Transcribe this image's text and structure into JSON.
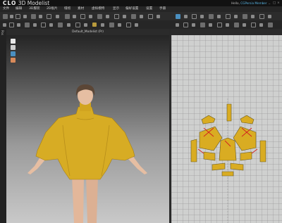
{
  "app": {
    "brand": "CLO",
    "product": "3D Modelist",
    "greeting_prefix": "Hello,",
    "user_name": "CGPersia Member",
    "window_controls": [
      "_",
      "□",
      "×"
    ]
  },
  "menu": {
    "items": [
      "文件",
      "编辑",
      "3D服装",
      "2D板片",
      "缝纫",
      "素材",
      "虚拟模特",
      "显示",
      "偏好设置",
      "设置",
      "手册"
    ]
  },
  "panel3d": {
    "title": "Default_Modelist (Pr)",
    "side_label": "Pos"
  },
  "colors": {
    "garment": "#d7ac24",
    "accent_blue": "#4a8fc0",
    "menu_bg": "#262626",
    "grid_bg": "#cfd0cf",
    "highlight_red": "#d02020"
  },
  "icons": {
    "toolbar_row1": [
      "select-icon",
      "move-icon",
      "transform-icon",
      "simulate-icon",
      "pin-icon",
      "fold-icon",
      "seam-icon",
      "layer-icon"
    ],
    "toolbar_row2": [
      "edit-pattern-icon",
      "polygon-icon",
      "rectangle-icon",
      "circle-icon",
      "internal-line-icon",
      "dart-icon",
      "notch-icon",
      "trace-icon"
    ],
    "view3d": [
      "view-front-icon",
      "view-wire-icon",
      "view-avatar-icon",
      "view-texture-icon"
    ]
  }
}
